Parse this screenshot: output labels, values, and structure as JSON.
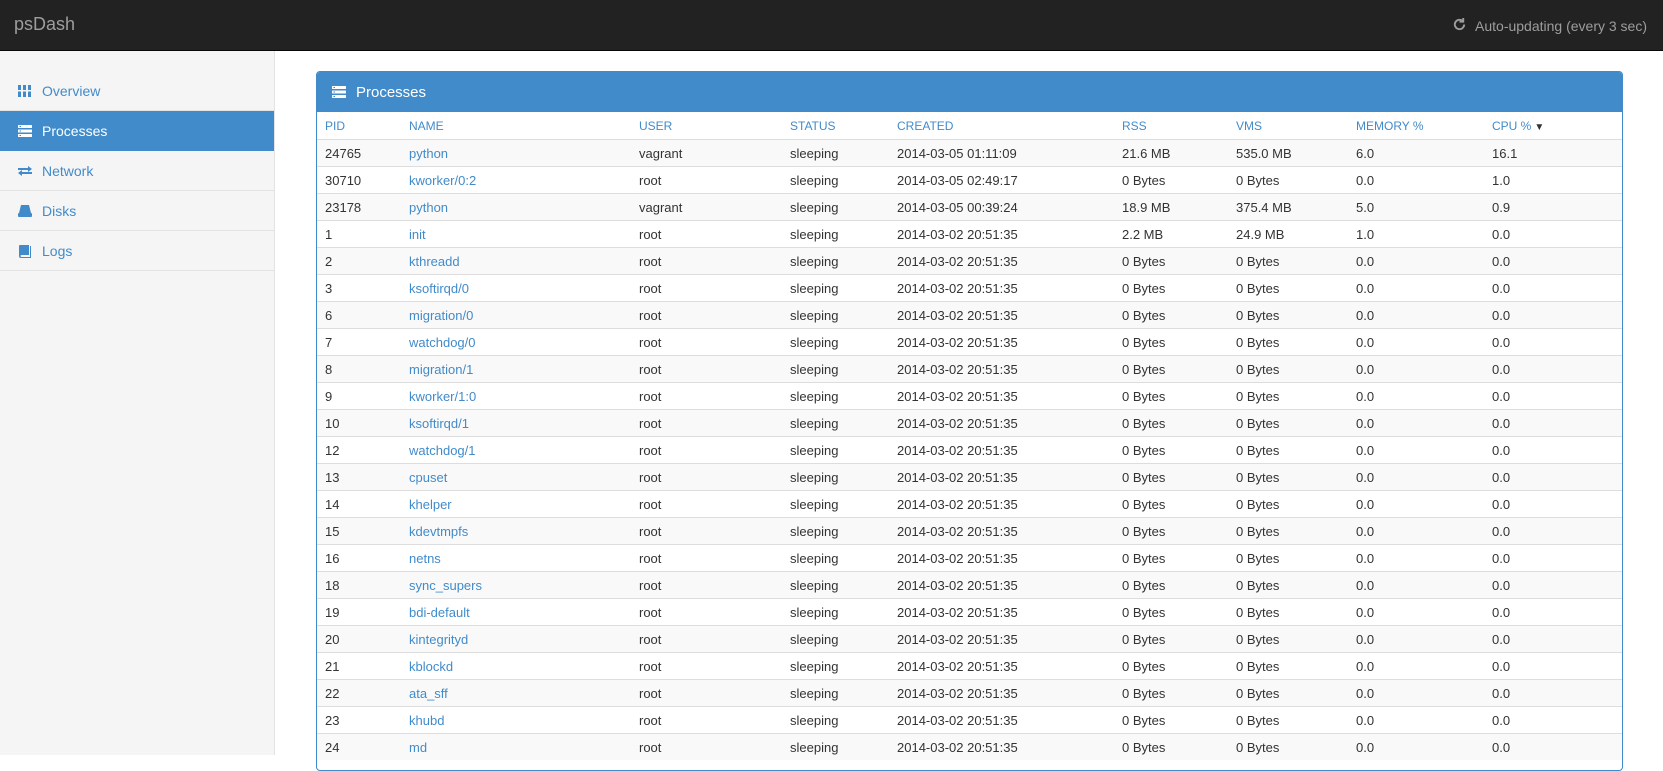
{
  "app": {
    "brand": "psDash",
    "auto_update_label": "Auto-updating (every 3 sec)"
  },
  "sidebar": {
    "items": [
      {
        "label": "Overview",
        "icon": "grid-icon",
        "active": false
      },
      {
        "label": "Processes",
        "icon": "list-icon",
        "active": true
      },
      {
        "label": "Network",
        "icon": "transfer-icon",
        "active": false
      },
      {
        "label": "Disks",
        "icon": "hdd-icon",
        "active": false
      },
      {
        "label": "Logs",
        "icon": "book-icon",
        "active": false
      }
    ]
  },
  "panel": {
    "title": "Processes",
    "sort_column": "CPU %",
    "sort_direction": "desc",
    "columns": [
      "PID",
      "NAME",
      "USER",
      "STATUS",
      "CREATED",
      "RSS",
      "VMS",
      "MEMORY %",
      "CPU %"
    ],
    "rows": [
      [
        "24765",
        "python",
        "vagrant",
        "sleeping",
        "2014-03-05 01:11:09",
        "21.6 MB",
        "535.0 MB",
        "6.0",
        "16.1"
      ],
      [
        "30710",
        "kworker/0:2",
        "root",
        "sleeping",
        "2014-03-05 02:49:17",
        "0 Bytes",
        "0 Bytes",
        "0.0",
        "1.0"
      ],
      [
        "23178",
        "python",
        "vagrant",
        "sleeping",
        "2014-03-05 00:39:24",
        "18.9 MB",
        "375.4 MB",
        "5.0",
        "0.9"
      ],
      [
        "1",
        "init",
        "root",
        "sleeping",
        "2014-03-02 20:51:35",
        "2.2 MB",
        "24.9 MB",
        "1.0",
        "0.0"
      ],
      [
        "2",
        "kthreadd",
        "root",
        "sleeping",
        "2014-03-02 20:51:35",
        "0 Bytes",
        "0 Bytes",
        "0.0",
        "0.0"
      ],
      [
        "3",
        "ksoftirqd/0",
        "root",
        "sleeping",
        "2014-03-02 20:51:35",
        "0 Bytes",
        "0 Bytes",
        "0.0",
        "0.0"
      ],
      [
        "6",
        "migration/0",
        "root",
        "sleeping",
        "2014-03-02 20:51:35",
        "0 Bytes",
        "0 Bytes",
        "0.0",
        "0.0"
      ],
      [
        "7",
        "watchdog/0",
        "root",
        "sleeping",
        "2014-03-02 20:51:35",
        "0 Bytes",
        "0 Bytes",
        "0.0",
        "0.0"
      ],
      [
        "8",
        "migration/1",
        "root",
        "sleeping",
        "2014-03-02 20:51:35",
        "0 Bytes",
        "0 Bytes",
        "0.0",
        "0.0"
      ],
      [
        "9",
        "kworker/1:0",
        "root",
        "sleeping",
        "2014-03-02 20:51:35",
        "0 Bytes",
        "0 Bytes",
        "0.0",
        "0.0"
      ],
      [
        "10",
        "ksoftirqd/1",
        "root",
        "sleeping",
        "2014-03-02 20:51:35",
        "0 Bytes",
        "0 Bytes",
        "0.0",
        "0.0"
      ],
      [
        "12",
        "watchdog/1",
        "root",
        "sleeping",
        "2014-03-02 20:51:35",
        "0 Bytes",
        "0 Bytes",
        "0.0",
        "0.0"
      ],
      [
        "13",
        "cpuset",
        "root",
        "sleeping",
        "2014-03-02 20:51:35",
        "0 Bytes",
        "0 Bytes",
        "0.0",
        "0.0"
      ],
      [
        "14",
        "khelper",
        "root",
        "sleeping",
        "2014-03-02 20:51:35",
        "0 Bytes",
        "0 Bytes",
        "0.0",
        "0.0"
      ],
      [
        "15",
        "kdevtmpfs",
        "root",
        "sleeping",
        "2014-03-02 20:51:35",
        "0 Bytes",
        "0 Bytes",
        "0.0",
        "0.0"
      ],
      [
        "16",
        "netns",
        "root",
        "sleeping",
        "2014-03-02 20:51:35",
        "0 Bytes",
        "0 Bytes",
        "0.0",
        "0.0"
      ],
      [
        "18",
        "sync_supers",
        "root",
        "sleeping",
        "2014-03-02 20:51:35",
        "0 Bytes",
        "0 Bytes",
        "0.0",
        "0.0"
      ],
      [
        "19",
        "bdi-default",
        "root",
        "sleeping",
        "2014-03-02 20:51:35",
        "0 Bytes",
        "0 Bytes",
        "0.0",
        "0.0"
      ],
      [
        "20",
        "kintegrityd",
        "root",
        "sleeping",
        "2014-03-02 20:51:35",
        "0 Bytes",
        "0 Bytes",
        "0.0",
        "0.0"
      ],
      [
        "21",
        "kblockd",
        "root",
        "sleeping",
        "2014-03-02 20:51:35",
        "0 Bytes",
        "0 Bytes",
        "0.0",
        "0.0"
      ],
      [
        "22",
        "ata_sff",
        "root",
        "sleeping",
        "2014-03-02 20:51:35",
        "0 Bytes",
        "0 Bytes",
        "0.0",
        "0.0"
      ],
      [
        "23",
        "khubd",
        "root",
        "sleeping",
        "2014-03-02 20:51:35",
        "0 Bytes",
        "0 Bytes",
        "0.0",
        "0.0"
      ],
      [
        "24",
        "md",
        "root",
        "sleeping",
        "2014-03-02 20:51:35",
        "0 Bytes",
        "0 Bytes",
        "0.0",
        "0.0"
      ]
    ]
  },
  "colors": {
    "accent": "#428bca",
    "topbar": "#222222",
    "sidebar": "#f5f5f5"
  }
}
